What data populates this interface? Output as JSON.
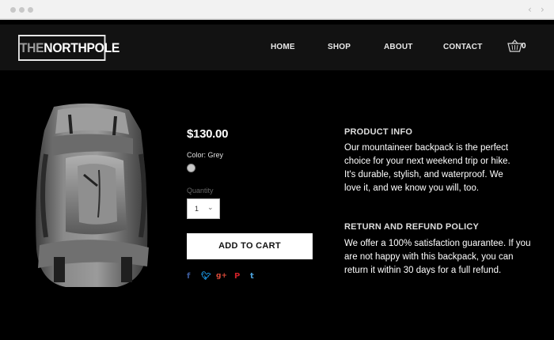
{
  "browser": {
    "back_icon": "chevron-left-icon",
    "forward_icon": "chevron-right-icon"
  },
  "header": {
    "logo_the": "THE",
    "logo_rest": "NORTHPOLE",
    "nav": {
      "home": "HOME",
      "shop": "SHOP",
      "about": "ABOUT",
      "contact": "CONTACT"
    },
    "cart_icon": "basket-icon",
    "cart_count": "0"
  },
  "product": {
    "image_icon": "backpack-image",
    "price": "$130.00",
    "color_label": "Color: Grey",
    "color_swatch": "#c9c9c9",
    "quantity_label": "Quantity",
    "quantity_value": "1",
    "add_to_cart": "ADD TO CART",
    "share_icons": [
      "facebook-icon",
      "twitter-icon",
      "google-plus-icon",
      "pinterest-icon",
      "tumblr-icon"
    ]
  },
  "info": {
    "product_title": "PRODUCT INFO",
    "product_lines": [
      "Our mountaineer backpack is the perfect",
      "choice for your next weekend trip or hike.",
      "It's durable, stylish, and waterproof. We",
      "love it, and we know you will, too."
    ],
    "policy_title": "RETURN AND REFUND POLICY",
    "policy_lines": [
      "We offer a 100% satisfaction guarantee. If you",
      "are not happy with this backpack, you can",
      "return it within 30 days for a full refund."
    ]
  },
  "colors": {
    "background": "#000000",
    "header": "#121212",
    "button": "#ffffff"
  }
}
